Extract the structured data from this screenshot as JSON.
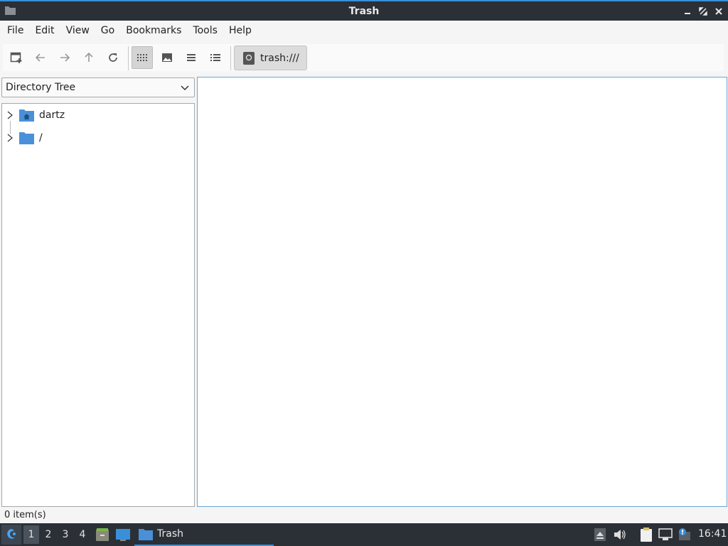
{
  "window": {
    "title": "Trash"
  },
  "menubar": {
    "items": [
      {
        "label": "File"
      },
      {
        "label": "Edit"
      },
      {
        "label": "View"
      },
      {
        "label": "Go"
      },
      {
        "label": "Bookmarks"
      },
      {
        "label": "Tools"
      },
      {
        "label": "Help"
      }
    ]
  },
  "toolbar": {
    "buttons": [
      "new-tab-icon",
      "back-icon",
      "forward-icon",
      "up-icon",
      "reload-icon",
      "icon-view-icon",
      "thumbnail-view-icon",
      "compact-view-icon",
      "detailed-list-view-icon"
    ],
    "active_view": "icon-view",
    "path": "trash:///"
  },
  "side_pane": {
    "mode": "Directory Tree",
    "tree": [
      {
        "label": "dartz",
        "icon": "home-folder-icon"
      },
      {
        "label": "/",
        "icon": "folder-icon"
      }
    ]
  },
  "status": {
    "text": "0 item(s)"
  },
  "taskbar": {
    "workspaces": [
      "1",
      "2",
      "3",
      "4"
    ],
    "active_workspace": "1",
    "task_label": "Trash",
    "clock": "16:41"
  },
  "colors": {
    "titlebar": "#2b3036",
    "accent": "#3a8fd9",
    "folder": "#4a90d9"
  }
}
